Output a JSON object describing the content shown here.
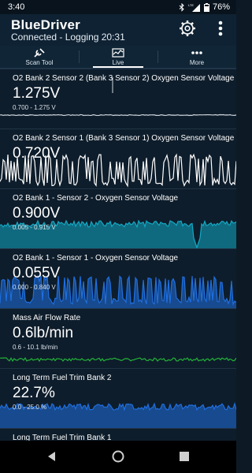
{
  "status_bar": {
    "time": "3:40",
    "battery": "76%",
    "icons": [
      "bluetooth-icon",
      "lte-signal-icon",
      "battery-icon"
    ]
  },
  "header": {
    "brand_part1": "Blue",
    "brand_part2": "Driver",
    "subtitle": "Connected - Logging 20:31",
    "icons": [
      "gear-icon",
      "more-icon"
    ]
  },
  "tabs": [
    {
      "label": "Scan Tool",
      "icon": "scan-tool-icon"
    },
    {
      "label": "Live",
      "icon": "live-graph-icon",
      "active": true
    },
    {
      "label": "More",
      "icon": "more-dots-icon"
    }
  ],
  "sensors": [
    {
      "title": "O2 Bank 2 Sensor 2 (Bank 3 Sensor 2) Oxygen Sensor Voltage",
      "value": "1.275V",
      "range": "0.700 - 1.275 V",
      "graph_color": "#cfd6dd"
    },
    {
      "title": "O2 Bank 2 Sensor 1 (Bank 3 Sensor 1) Oxygen Sensor Voltage",
      "value": "0.720V",
      "range": "",
      "graph_color": "#ffffff"
    },
    {
      "title": "O2 Bank 1 - Sensor 2 - Oxygen Sensor Voltage",
      "value": "0.900V",
      "range": "0.005 - 0.915 V",
      "graph_color": "#12a9c4"
    },
    {
      "title": "O2 Bank 1 - Sensor 1 - Oxygen Sensor Voltage",
      "value": "0.055V",
      "range": "0.000 - 0.840 V",
      "graph_color": "#1f6fe0"
    },
    {
      "title": "Mass Air Flow Rate",
      "value": "0.6lb/min",
      "range": "0.6 - 10.1 lb/min",
      "graph_color": "#23b23a"
    },
    {
      "title": "Long Term Fuel Trim Bank 2",
      "value": "22.7%",
      "range": "0.0 - 25.0 %",
      "graph_color": "#1f6fe0"
    },
    {
      "title": "Long Term Fuel Trim Bank 1",
      "value": "",
      "range": "",
      "graph_color": "#1f6fe0"
    }
  ],
  "nav": [
    "back-icon",
    "home-icon",
    "recents-icon"
  ]
}
